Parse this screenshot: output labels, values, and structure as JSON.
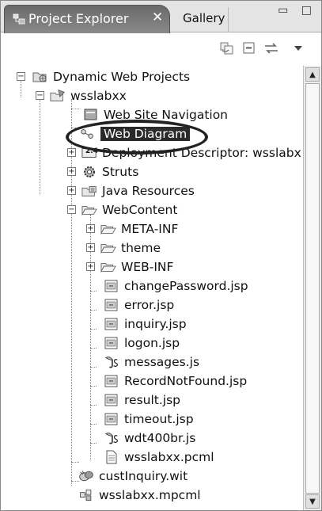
{
  "tabs": {
    "active_label": "Project Explorer",
    "close_glyph": "✕",
    "inactive_label": "Gallery",
    "window_buttons": "▭ □"
  },
  "toolbar": {
    "icons": [
      "link-with-editor-icon",
      "collapse-all-icon",
      "sync-icon",
      "view-menu-icon"
    ]
  },
  "tree": {
    "items": [
      {
        "label": "Dynamic Web Projects",
        "icon": "web-projects-folder-icon",
        "expander": "−"
      },
      {
        "label": "wsslabxx",
        "icon": "web-project-icon",
        "expander": "−"
      },
      {
        "label": "Web Site Navigation",
        "icon": "site-navigation-icon"
      },
      {
        "label": "Web Diagram",
        "icon": "web-diagram-icon",
        "selected": true
      },
      {
        "label": "Deployment Descriptor: wsslabxx",
        "icon": "deployment-descriptor-icon",
        "expander": "+",
        "badge": "2.4"
      },
      {
        "label": "Struts",
        "icon": "gear-icon",
        "expander": "+"
      },
      {
        "label": "Java Resources",
        "icon": "java-resources-icon",
        "expander": "+"
      },
      {
        "label": "WebContent",
        "icon": "folder-open-icon",
        "expander": "−"
      },
      {
        "label": "META-INF",
        "icon": "folder-icon",
        "expander": "+"
      },
      {
        "label": "theme",
        "icon": "folder-icon",
        "expander": "+"
      },
      {
        "label": "WEB-INF",
        "icon": "folder-icon",
        "expander": "+"
      },
      {
        "label": "changePassword.jsp",
        "icon": "jsp-file-icon"
      },
      {
        "label": "error.jsp",
        "icon": "jsp-file-icon"
      },
      {
        "label": "inquiry.jsp",
        "icon": "jsp-file-icon"
      },
      {
        "label": "logon.jsp",
        "icon": "jsp-file-icon"
      },
      {
        "label": "messages.js",
        "icon": "js-file-icon"
      },
      {
        "label": "RecordNotFound.jsp",
        "icon": "jsp-file-icon"
      },
      {
        "label": "result.jsp",
        "icon": "jsp-file-icon"
      },
      {
        "label": "timeout.jsp",
        "icon": "jsp-file-icon"
      },
      {
        "label": "wdt400br.js",
        "icon": "js-file-icon"
      },
      {
        "label": "wsslabxx.pcml",
        "icon": "pcml-file-icon"
      },
      {
        "label": "custInquiry.wit",
        "icon": "wit-file-icon"
      },
      {
        "label": "wsslabxx.mpcml",
        "icon": "mpcml-file-icon"
      }
    ]
  },
  "scrollbar": {
    "up_glyph": "▲",
    "down_glyph": "▼"
  }
}
